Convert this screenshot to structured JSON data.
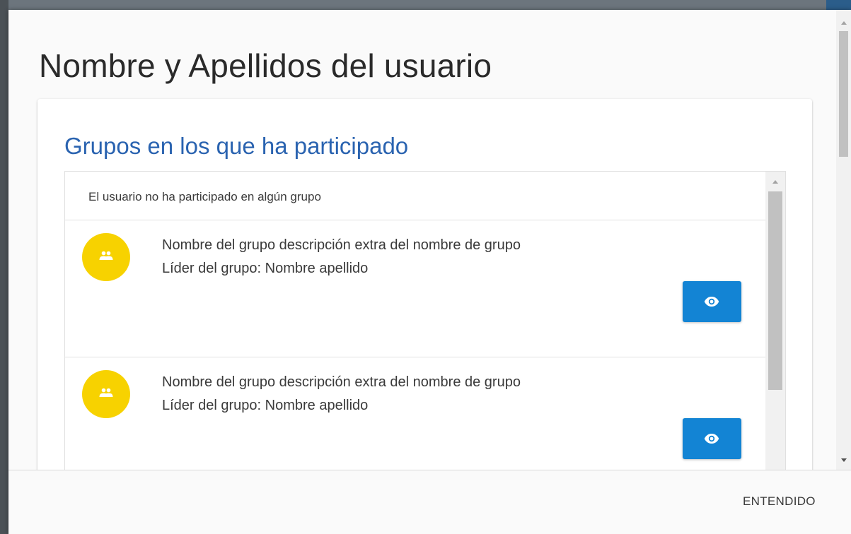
{
  "dialog": {
    "title": "Nombre y Apellidos del usuario"
  },
  "groups_section": {
    "heading": "Grupos en los que ha participado",
    "empty_message": "El usuario no ha participado en algún grupo",
    "items": [
      {
        "name": "Nombre del grupo descripción extra del nombre de grupo",
        "leader": "Líder del grupo: Nombre apellido",
        "avatar_icon": "group-icon",
        "action_icon": "eye-icon"
      },
      {
        "name": "Nombre del grupo descripción extra del nombre de grupo",
        "leader": "Líder del grupo: Nombre apellido",
        "avatar_icon": "group-icon",
        "action_icon": "eye-icon"
      }
    ]
  },
  "actions": {
    "ok_label": "ENTENDIDO"
  },
  "colors": {
    "heading": "#2a63b0",
    "avatar": "#f7d200",
    "view_button": "#1384d4"
  }
}
